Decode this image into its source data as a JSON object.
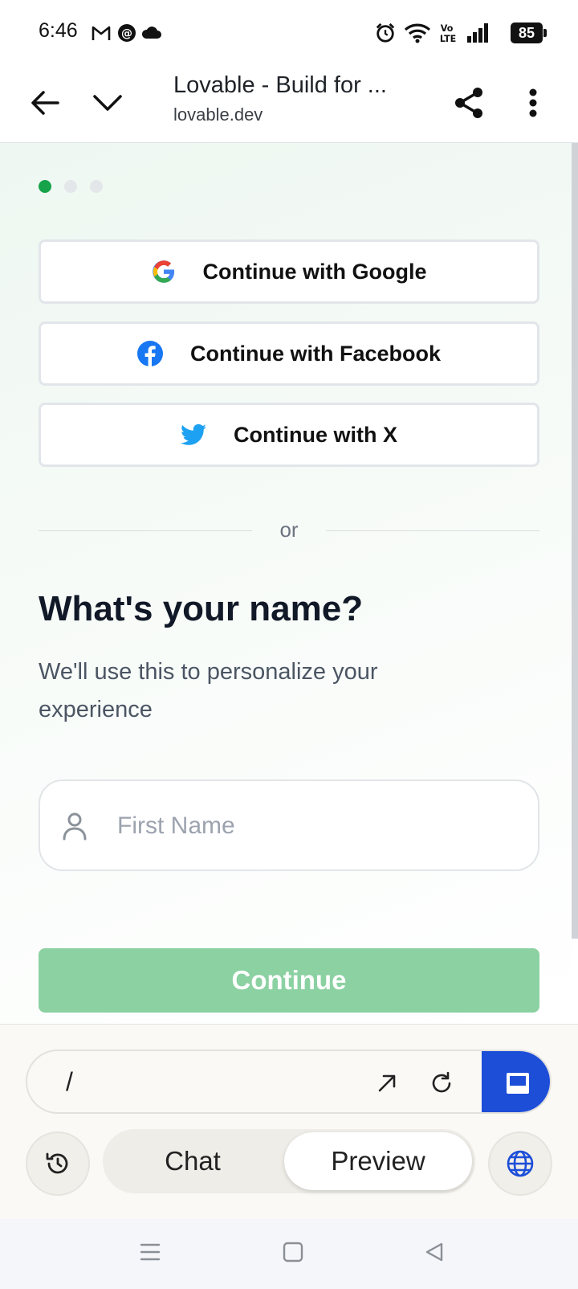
{
  "status_bar": {
    "time": "6:46",
    "battery": "85",
    "icons": [
      "gmail-icon",
      "threads-icon",
      "cloud-icon",
      "alarm-icon",
      "wifi-icon",
      "volte-icon",
      "signal-icon",
      "battery-icon"
    ]
  },
  "browser": {
    "page_title": "Lovable - Build for ...",
    "url": "lovable.dev",
    "icons": [
      "back-arrow-icon",
      "chevron-down-icon",
      "share-icon",
      "more-vert-icon"
    ]
  },
  "auth": {
    "google_label": "Continue with Google",
    "facebook_label": "Continue with Facebook",
    "x_label": "Continue with X",
    "divider_text": "or"
  },
  "name_step": {
    "heading": "What's your name?",
    "subheading": "We'll use this to personalize your experience",
    "first_name_placeholder": "First Name",
    "first_name_value": "",
    "continue_label": "Continue",
    "step_total": 3,
    "step_active": 1
  },
  "bottom_panel": {
    "path": "/",
    "tabs": {
      "chat": "Chat",
      "preview": "Preview"
    },
    "active_tab": "Preview"
  },
  "colors": {
    "accent_green": "#16a34a",
    "continue_disabled": "#8bd1a2",
    "brand_blue": "#1d4ed8",
    "facebook_blue": "#1877f2",
    "twitter_blue": "#1da1f2"
  }
}
